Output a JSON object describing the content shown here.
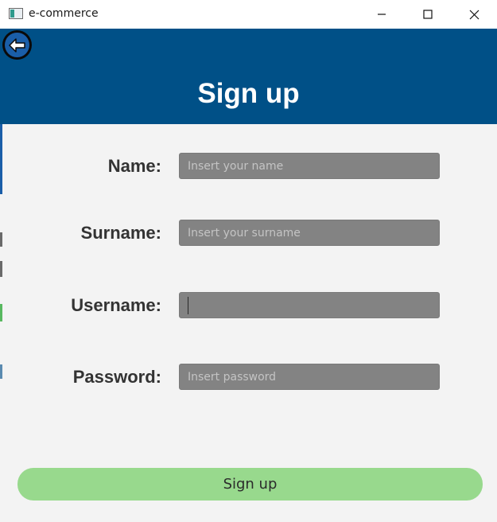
{
  "window": {
    "title": "e-commerce",
    "icons": {
      "app": "app-window-icon",
      "minimize": "minimize-icon",
      "maximize": "maximize-icon",
      "close": "close-icon",
      "back": "back-arrow-icon"
    }
  },
  "header": {
    "title": "Sign up"
  },
  "form": {
    "name": {
      "label": "Name:",
      "placeholder": "Insert your name",
      "value": ""
    },
    "surname": {
      "label": "Surname:",
      "placeholder": "Insert your surname",
      "value": ""
    },
    "username": {
      "label": "Username:",
      "placeholder": "",
      "value": "",
      "focused": true
    },
    "password": {
      "label": "Password:",
      "placeholder": "Insert password",
      "value": ""
    }
  },
  "actions": {
    "signup_label": "Sign up"
  },
  "colors": {
    "header_bg": "#005087",
    "body_bg": "#f3f3f3",
    "input_bg": "#838383",
    "button_bg": "#98d98d",
    "label_text": "#333333"
  }
}
